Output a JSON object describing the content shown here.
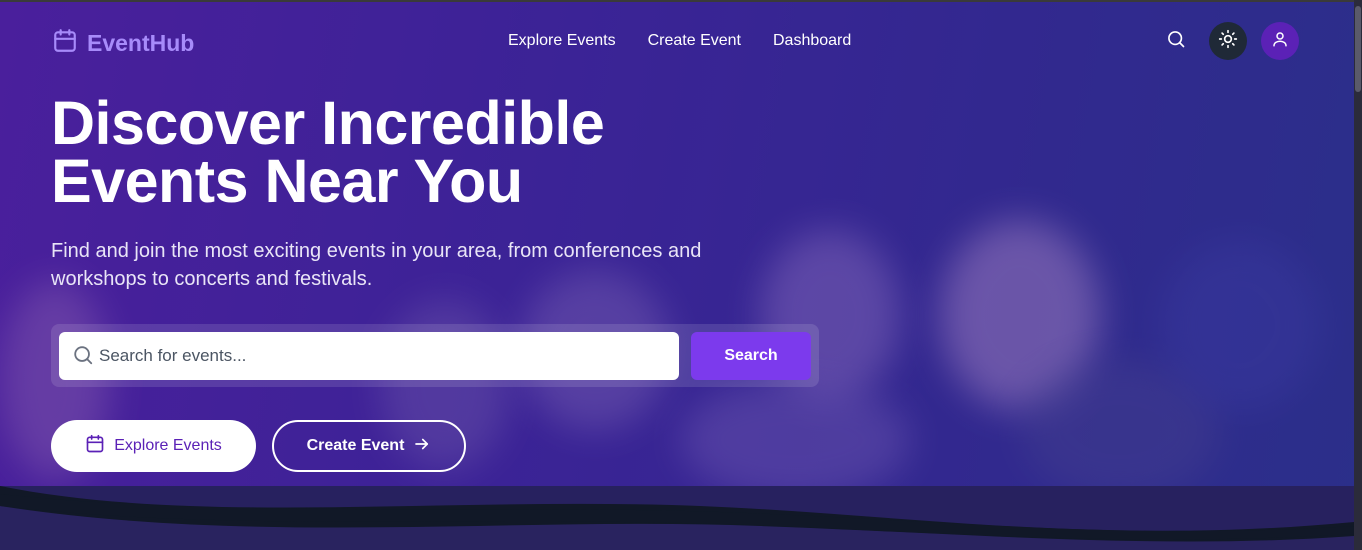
{
  "brand": {
    "name": "EventHub",
    "color": "#a78bfa",
    "icon": "calendar-icon"
  },
  "nav": {
    "links": [
      "Explore Events",
      "Create Event",
      "Dashboard"
    ],
    "search_icon": "search-icon",
    "theme_icon": "sun-icon",
    "profile_icon": "user-icon"
  },
  "hero": {
    "headline_line1": "Discover Incredible",
    "headline_line2": "Events Near You",
    "subtext": "Find and join the most exciting events in your area, from conferences and workshops to concerts and festivals.",
    "search": {
      "placeholder": "Search for events...",
      "value": "",
      "button_label": "Search"
    },
    "primary_cta": {
      "label": "Explore Events",
      "icon": "calendar-icon"
    },
    "secondary_cta": {
      "label": "Create Event",
      "icon": "arrow-right-icon"
    }
  },
  "colors": {
    "accent": "#7c3aed",
    "hero_start": "#4a1f9c",
    "hero_end": "#2b2f8a",
    "footer_bg": "#111827"
  }
}
